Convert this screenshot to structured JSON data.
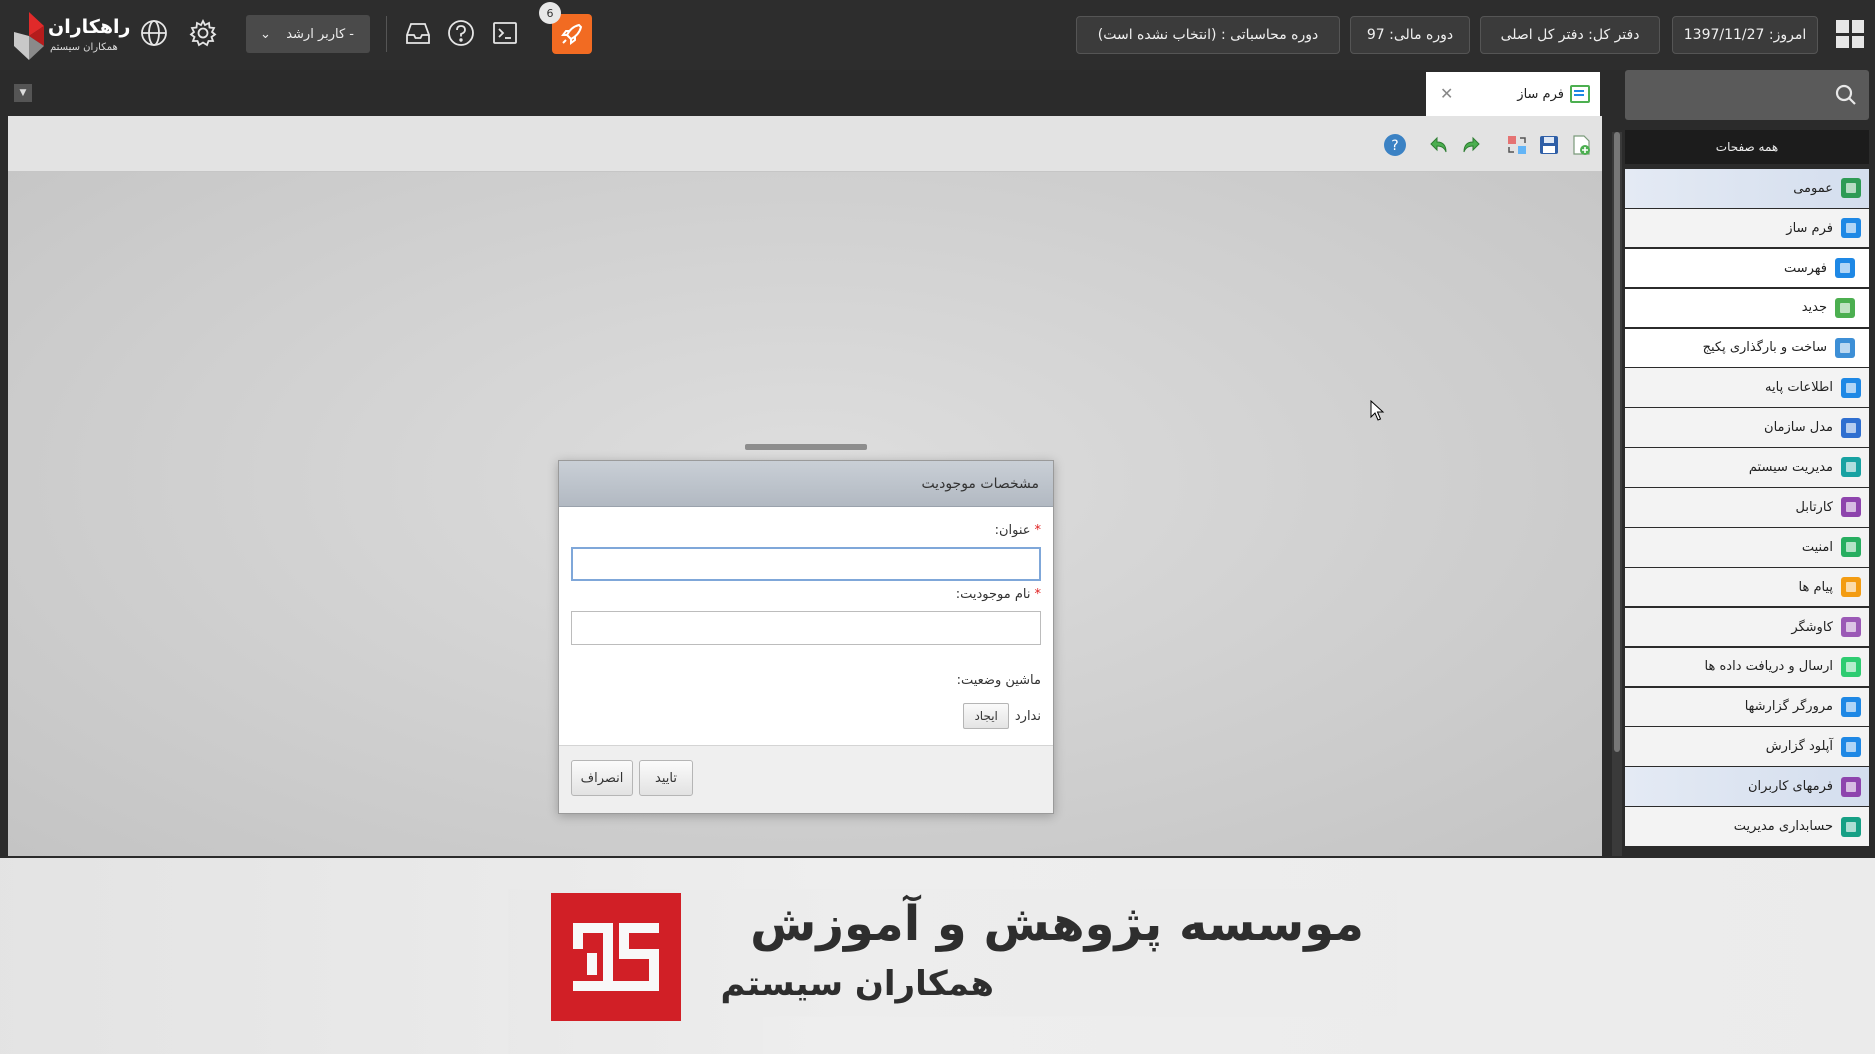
{
  "header": {
    "logo_title": "راهکاران",
    "logo_subtitle": "همکاران سیستم",
    "user_dropdown": "کاربر ارشد -",
    "notification_count": "6",
    "date": "امروز: 1397/11/27",
    "office": "دفتر کل: دفتر کل اصلی",
    "fiscal_year": "دوره مالی: 97",
    "accounting_period": "دوره محاسباتی : (انتخاب نشده است)"
  },
  "tab": {
    "label": "فرم ساز"
  },
  "sidebar": {
    "search_placeholder": "",
    "all_pages": "همه صفحات",
    "items": [
      {
        "label": "عمومی",
        "icon": "general-icon",
        "color": "#2e9b55"
      },
      {
        "label": "فرم ساز",
        "icon": "form-builder-icon",
        "color": "#1e88e5"
      },
      {
        "label": "فهرست",
        "icon": "list-icon",
        "color": "#1e88e5"
      },
      {
        "label": "جدید",
        "icon": "new-form-icon",
        "color": "#4caf50"
      },
      {
        "label": "ساخت و بارگذاری پکیج",
        "icon": "package-icon",
        "color": "#3d8fd6"
      },
      {
        "label": "اطلاعات پایه",
        "icon": "info-icon",
        "color": "#1e88e5"
      },
      {
        "label": "مدل سازمان",
        "icon": "organization-icon",
        "color": "#2f6fd0"
      },
      {
        "label": "مدیریت سیستم",
        "icon": "system-management-icon",
        "color": "#17a2a2"
      },
      {
        "label": "کارتابل",
        "icon": "cartable-icon",
        "color": "#8e44ad"
      },
      {
        "label": "امنیت",
        "icon": "shield-icon",
        "color": "#27ae60"
      },
      {
        "label": "پیام ها",
        "icon": "messages-icon",
        "color": "#f39c12"
      },
      {
        "label": "کاوشگر",
        "icon": "explorer-icon",
        "color": "#9b59b6"
      },
      {
        "label": "ارسال و دریافت داده ها",
        "icon": "data-transfer-icon",
        "color": "#2ecc71"
      },
      {
        "label": "مرورگر گزارشها",
        "icon": "report-browser-icon",
        "color": "#1e88e5"
      },
      {
        "label": "آپلود گزارش",
        "icon": "report-upload-icon",
        "color": "#1e88e5"
      },
      {
        "label": "فرمهای کاربران",
        "icon": "user-forms-icon",
        "color": "#8e44ad"
      },
      {
        "label": "حسابداری مدیریت",
        "icon": "management-accounting-icon",
        "color": "#16a085"
      }
    ]
  },
  "dialog": {
    "title": "مشخصات موجودیت",
    "title_label": "عنوان:",
    "title_value": "",
    "name_label": "نام موجودیت:",
    "name_value": "",
    "state_machine_label": "ماشین وضعیت:",
    "state_machine_value": "ندارد",
    "create_button": "ایجاد",
    "ok_button": "تایید",
    "cancel_button": "انصراف"
  },
  "banner": {
    "title": "موسسه پژوهش و آموزش",
    "subtitle": "همکاران سیستم"
  },
  "colors": {
    "accent_orange": "#f26b22",
    "banner_red": "#d71f26",
    "topbar": "#2d2d2d"
  }
}
